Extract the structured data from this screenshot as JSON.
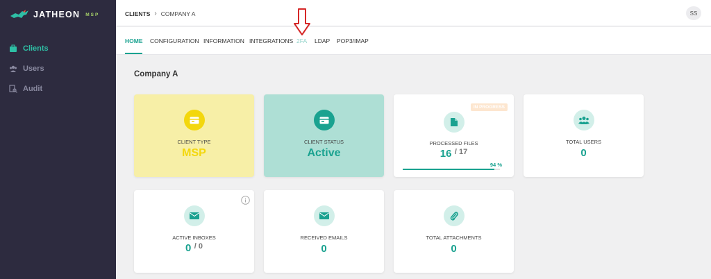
{
  "brand": {
    "name": "JATHEON",
    "sub": "MSP",
    "accent": "#1aa290"
  },
  "sidebar": {
    "items": [
      {
        "label": "Clients",
        "icon": "briefcase-icon",
        "active": true
      },
      {
        "label": "Users",
        "icon": "users-icon",
        "active": false
      },
      {
        "label": "Audit",
        "icon": "audit-icon",
        "active": false
      }
    ]
  },
  "breadcrumb": {
    "root": "CLIENTS",
    "current": "COMPANY A"
  },
  "user": {
    "initials": "SS"
  },
  "tabs": [
    "HOME",
    "CONFIGURATION",
    "INFORMATION",
    "INTEGRATIONS",
    "2FA",
    "LDAP",
    "POP3/IMAP"
  ],
  "page": {
    "title": "Company A"
  },
  "cards": {
    "client_type": {
      "label": "CLIENT TYPE",
      "value": "MSP",
      "icon": "card-icon"
    },
    "client_status": {
      "label": "CLIENT STATUS",
      "value": "Active",
      "icon": "card-icon"
    },
    "processed_files": {
      "label": "PROCESSED FILES",
      "value": "16",
      "total": "/ 17",
      "badge": "IN PROGRESS",
      "progress": 94,
      "progress_text": "94 %",
      "icon": "file-icon"
    },
    "total_users": {
      "label": "TOTAL USERS",
      "value": "0",
      "icon": "users-icon"
    },
    "active_inboxes": {
      "label": "ACTIVE INBOXES",
      "value": "0",
      "total": "/ 0",
      "icon": "envelope-icon"
    },
    "received_emails": {
      "label": "RECEIVED EMAILS",
      "value": "0",
      "icon": "envelope-icon"
    },
    "total_attachments": {
      "label": "TOTAL ATTACHMENTS",
      "value": "0",
      "icon": "paperclip-icon"
    }
  }
}
